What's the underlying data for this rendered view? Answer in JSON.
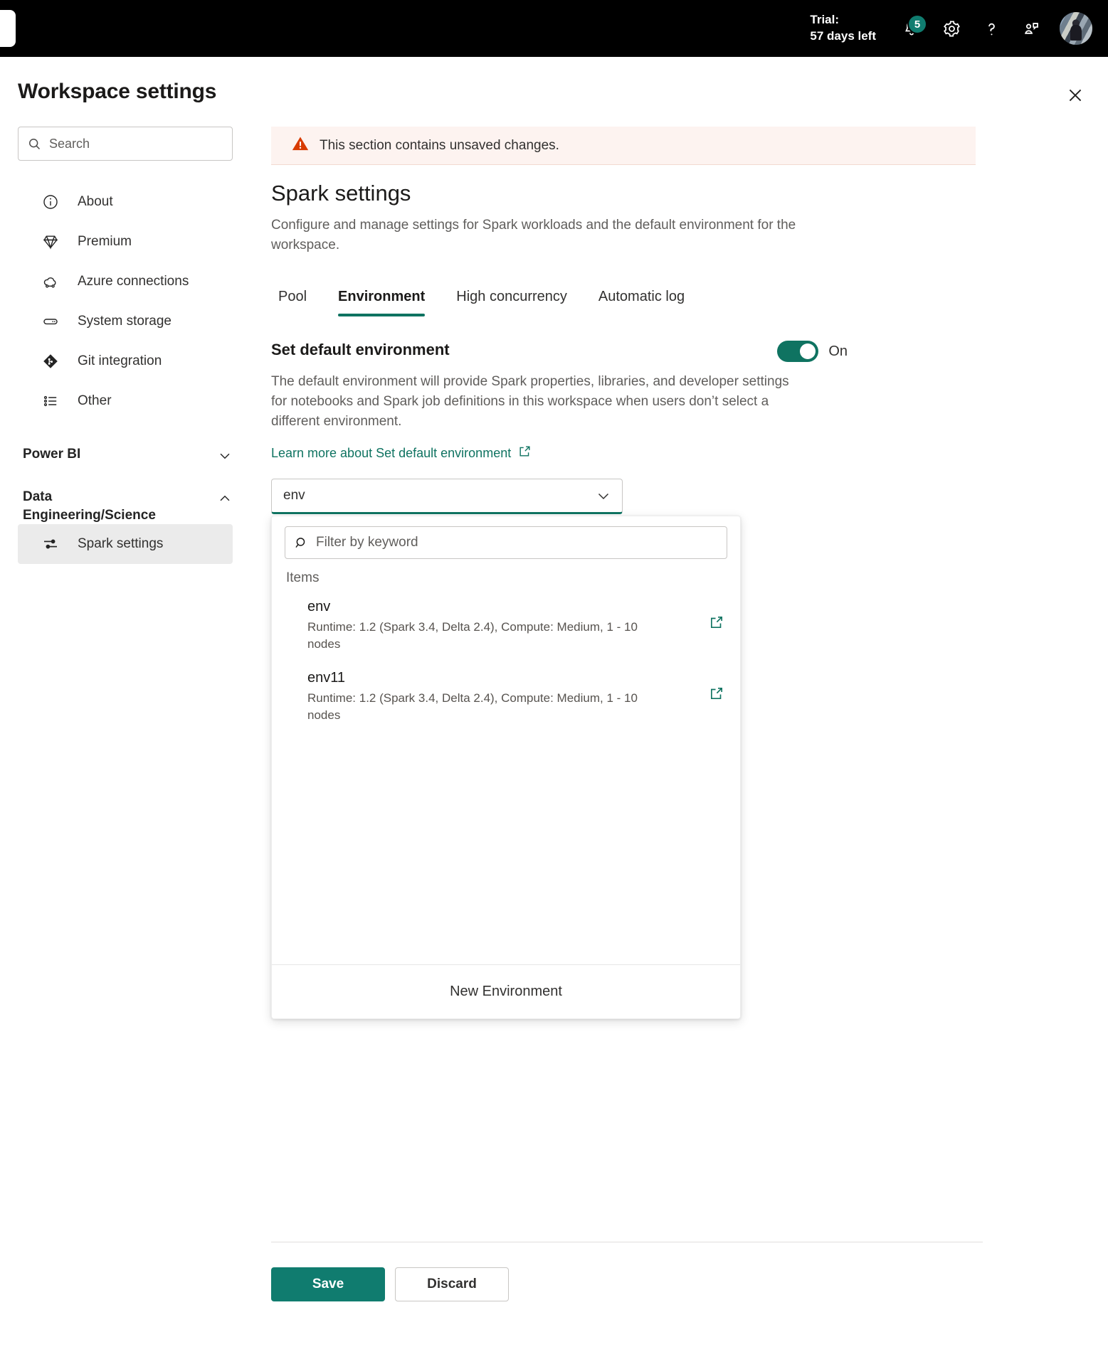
{
  "topbar": {
    "trial_line1": "Trial:",
    "trial_line2": "57 days left",
    "notifications_badge": "5",
    "icons": {
      "notifications": "bell-icon",
      "settings": "gear-icon",
      "help": "question-mark-icon",
      "feedback": "feedback-icon",
      "avatar": "user-avatar"
    }
  },
  "header": {
    "title": "Workspace settings",
    "close_label": "Close"
  },
  "sidebar": {
    "search": {
      "value": "",
      "placeholder": "Search"
    },
    "items": [
      {
        "label": "About",
        "icon": "info-icon"
      },
      {
        "label": "Premium",
        "icon": "diamond-icon"
      },
      {
        "label": "Azure connections",
        "icon": "cloud-link-icon"
      },
      {
        "label": "System storage",
        "icon": "storage-icon"
      },
      {
        "label": "Git integration",
        "icon": "git-icon"
      },
      {
        "label": "Other",
        "icon": "list-icon"
      }
    ],
    "groups": [
      {
        "label": "Power BI",
        "expanded": false,
        "children": []
      },
      {
        "label": "Data Engineering/Science",
        "expanded": true,
        "children": [
          {
            "label": "Spark settings",
            "icon": "sliders-icon",
            "selected": true
          }
        ]
      }
    ]
  },
  "main": {
    "banner": {
      "text": "This section contains unsaved changes.",
      "icon": "warning-icon"
    },
    "title": "Spark settings",
    "subtitle": "Configure and manage settings for Spark workloads and the default environment for the workspace.",
    "tabs": [
      {
        "label": "Pool",
        "active": false
      },
      {
        "label": "Environment",
        "active": true
      },
      {
        "label": "High concurrency",
        "active": false
      },
      {
        "label": "Automatic log",
        "active": false
      }
    ],
    "setting": {
      "title": "Set default environment",
      "toggle_state": "On",
      "toggle_on": true,
      "description": "The default environment will provide Spark properties, libraries, and developer settings for notebooks and Spark job definitions in this workspace when users don’t select a different environment.",
      "learn_more": "Learn more about Set default environment"
    },
    "combobox": {
      "value": "env",
      "chevron": "chevron-down-icon"
    },
    "dropdown": {
      "filter": {
        "value": "",
        "placeholder": "Filter by keyword"
      },
      "section_label": "Items",
      "options": [
        {
          "name": "env",
          "meta": "Runtime: 1.2 (Spark 3.4, Delta 2.4), Compute: Medium, 1 - 10 nodes"
        },
        {
          "name": "env11",
          "meta": "Runtime: 1.2 (Spark 3.4, Delta 2.4), Compute: Medium, 1 - 10 nodes"
        }
      ],
      "footer_label": "New Environment"
    }
  },
  "footer": {
    "save_label": "Save",
    "discard_label": "Discard"
  },
  "colors": {
    "accent": "#107C6F",
    "tab_underline": "#0f7361",
    "banner_bg": "#fdf3f0",
    "warning": "#d83b01",
    "topbar_bg": "#000000",
    "selected_nav_bg": "#ebebeb"
  }
}
